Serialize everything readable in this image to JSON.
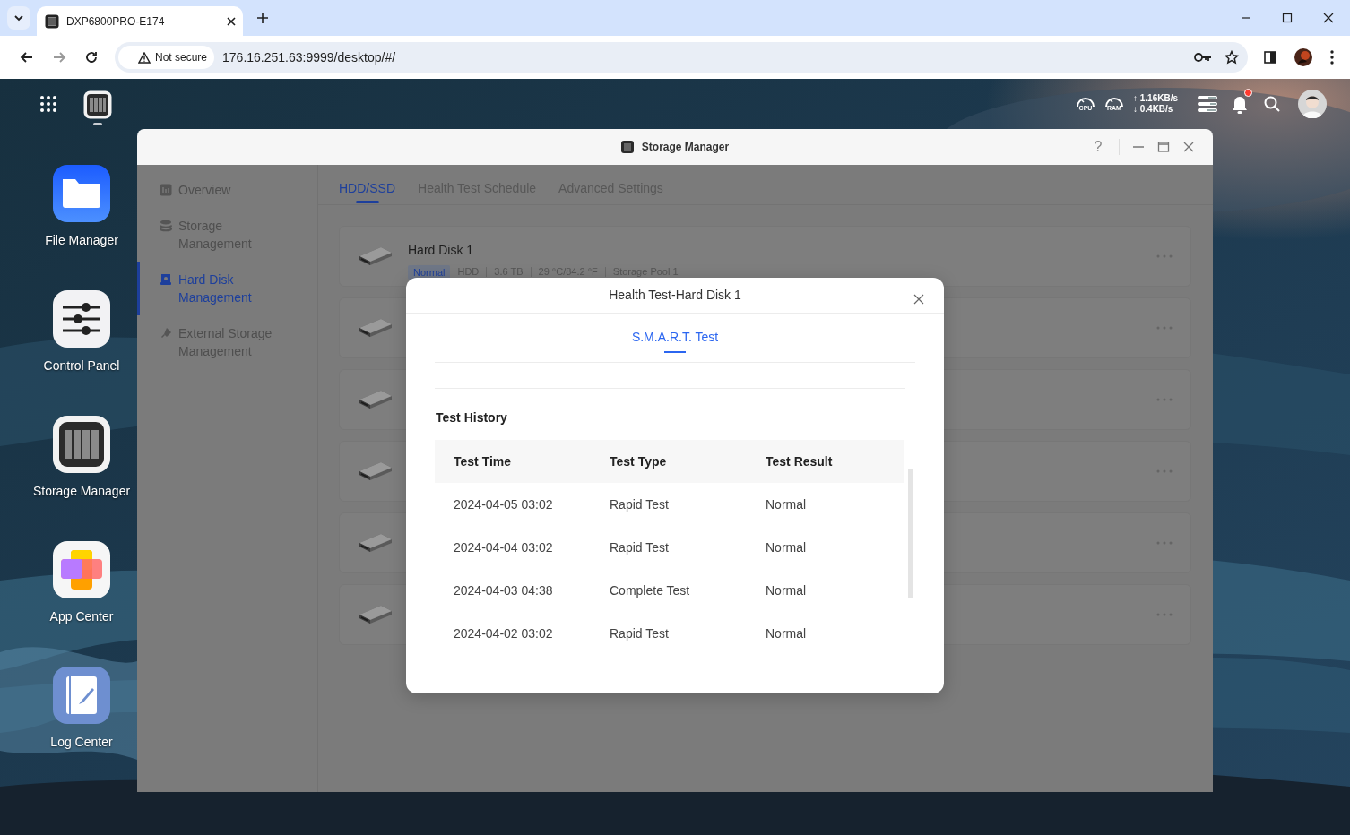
{
  "browser": {
    "tab_title": "DXP6800PRO-E174",
    "security": "Not secure",
    "url": "176.16.251.63:9999/desktop/#/"
  },
  "topbar": {
    "gauges": [
      "CPU",
      "RAM"
    ],
    "upload": "↑ 1.16KB/s",
    "download": "↓ 0.4KB/s",
    "notification_unread": true
  },
  "desktop_icons": [
    {
      "label": "File Manager"
    },
    {
      "label": "Control Panel"
    },
    {
      "label": "Storage Manager"
    },
    {
      "label": "App Center"
    },
    {
      "label": "Log Center"
    }
  ],
  "window": {
    "title": "Storage Manager",
    "help": "?"
  },
  "sidebar": {
    "items": [
      {
        "label": "Overview",
        "selected": false
      },
      {
        "label": "Storage Management",
        "selected": false
      },
      {
        "label": "Hard Disk Management",
        "selected": true
      },
      {
        "label": "External Storage Management",
        "selected": false
      }
    ]
  },
  "tabs": [
    {
      "label": "HDD/SSD",
      "selected": true
    },
    {
      "label": "Health Test Schedule",
      "selected": false
    },
    {
      "label": "Advanced Settings",
      "selected": false
    }
  ],
  "disks": [
    {
      "kind": "disk",
      "name": "Hard Disk 1",
      "status": "Normal",
      "details": [
        "HDD",
        "3.6 TB",
        "29 °C/84.2 °F",
        "Storage Pool 1"
      ]
    },
    {
      "kind": "disk"
    },
    {
      "kind": "disk"
    },
    {
      "kind": "disk"
    },
    {
      "kind": "disk"
    },
    {
      "kind": "disk"
    }
  ],
  "dialog": {
    "title": "Health Test-Hard Disk 1",
    "tabs": [
      {
        "label": "S.M.A.R.T. Test",
        "selected": true
      }
    ],
    "section_title": "Test History",
    "table": {
      "columns": [
        "Test Time",
        "Test Type",
        "Test Result"
      ],
      "rows": [
        [
          "2024-04-05 03:02",
          "Rapid Test",
          "Normal"
        ],
        [
          "2024-04-04 03:02",
          "Rapid Test",
          "Normal"
        ],
        [
          "2024-04-03 04:38",
          "Complete Test",
          "Normal"
        ],
        [
          "2024-04-02 03:02",
          "Rapid Test",
          "Normal"
        ]
      ]
    }
  }
}
